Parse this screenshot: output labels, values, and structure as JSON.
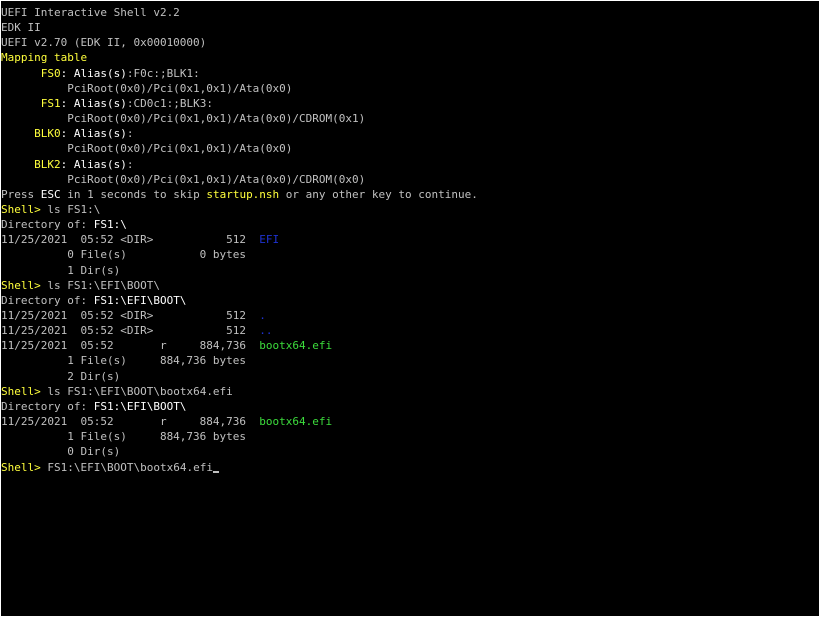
{
  "colors": {
    "background": "#000000",
    "text": "#c0c0c0",
    "highlight": "#ffffff",
    "prompt": "#ffff3c",
    "directory": "#1e32d2",
    "executable": "#3cdc3c"
  },
  "lines": [
    {
      "segments": [
        {
          "text": "UEFI Interactive Shell v2.2",
          "color": "gray"
        }
      ]
    },
    {
      "segments": [
        {
          "text": "EDK II",
          "color": "gray"
        }
      ]
    },
    {
      "segments": [
        {
          "text": "UEFI v2.70 (EDK II, 0x00010000)",
          "color": "gray"
        }
      ]
    },
    {
      "segments": [
        {
          "text": "Mapping table",
          "color": "yellow"
        }
      ]
    },
    {
      "segments": [
        {
          "text": "      FS0",
          "color": "yellow"
        },
        {
          "text": ": Alias(s)",
          "color": "white"
        },
        {
          "text": ":F0c:;BLK1:",
          "color": "gray"
        }
      ]
    },
    {
      "segments": [
        {
          "text": "          PciRoot(0x0)/Pci(0x1,0x1)/Ata(0x0)",
          "color": "gray"
        }
      ]
    },
    {
      "segments": [
        {
          "text": "      FS1",
          "color": "yellow"
        },
        {
          "text": ": Alias(s)",
          "color": "white"
        },
        {
          "text": ":CD0c1:;BLK3:",
          "color": "gray"
        }
      ]
    },
    {
      "segments": [
        {
          "text": "          PciRoot(0x0)/Pci(0x1,0x1)/Ata(0x0)/CDROM(0x1)",
          "color": "gray"
        }
      ]
    },
    {
      "segments": [
        {
          "text": "     BLK0",
          "color": "yellow"
        },
        {
          "text": ": Alias(s)",
          "color": "white"
        },
        {
          "text": ":",
          "color": "gray"
        }
      ]
    },
    {
      "segments": [
        {
          "text": "          PciRoot(0x0)/Pci(0x1,0x1)/Ata(0x0)",
          "color": "gray"
        }
      ]
    },
    {
      "segments": [
        {
          "text": "     BLK2",
          "color": "yellow"
        },
        {
          "text": ": Alias(s)",
          "color": "white"
        },
        {
          "text": ":",
          "color": "gray"
        }
      ]
    },
    {
      "segments": [
        {
          "text": "          PciRoot(0x0)/Pci(0x1,0x1)/Ata(0x0)/CDROM(0x0)",
          "color": "gray"
        }
      ]
    },
    {
      "segments": [
        {
          "text": "Press ",
          "color": "gray"
        },
        {
          "text": "ESC",
          "color": "white"
        },
        {
          "text": " in 1 seconds to skip ",
          "color": "gray"
        },
        {
          "text": "startup.nsh",
          "color": "yellow"
        },
        {
          "text": " or any other key to continue.",
          "color": "gray"
        }
      ]
    },
    {
      "segments": [
        {
          "text": "Shell>",
          "color": "yellow"
        },
        {
          "text": " ls FS1:\\",
          "color": "gray"
        }
      ]
    },
    {
      "segments": [
        {
          "text": "Directory of: ",
          "color": "gray"
        },
        {
          "text": "FS1:\\",
          "color": "white"
        }
      ]
    },
    {
      "segments": [
        {
          "text": "11/25/2021  05:52 <DIR>           512  ",
          "color": "gray"
        },
        {
          "text": "EFI",
          "color": "blue"
        }
      ]
    },
    {
      "segments": [
        {
          "text": "          0 File(s)           0 bytes",
          "color": "gray"
        }
      ]
    },
    {
      "segments": [
        {
          "text": "          1 Dir(s)",
          "color": "gray"
        }
      ]
    },
    {
      "segments": [
        {
          "text": "Shell>",
          "color": "yellow"
        },
        {
          "text": " ls FS1:\\EFI\\BOOT\\",
          "color": "gray"
        }
      ]
    },
    {
      "segments": [
        {
          "text": "Directory of: ",
          "color": "gray"
        },
        {
          "text": "FS1:\\EFI\\BOOT\\",
          "color": "white"
        }
      ]
    },
    {
      "segments": [
        {
          "text": "11/25/2021  05:52 <DIR>           512  ",
          "color": "gray"
        },
        {
          "text": ".",
          "color": "blue"
        }
      ]
    },
    {
      "segments": [
        {
          "text": "11/25/2021  05:52 <DIR>           512  ",
          "color": "gray"
        },
        {
          "text": "..",
          "color": "blue"
        }
      ]
    },
    {
      "segments": [
        {
          "text": "11/25/2021  05:52       r     884,736  ",
          "color": "gray"
        },
        {
          "text": "bootx64.efi",
          "color": "green"
        }
      ]
    },
    {
      "segments": [
        {
          "text": "          1 File(s)     884,736 bytes",
          "color": "gray"
        }
      ]
    },
    {
      "segments": [
        {
          "text": "          2 Dir(s)",
          "color": "gray"
        }
      ]
    },
    {
      "segments": [
        {
          "text": "Shell>",
          "color": "yellow"
        },
        {
          "text": " ls FS1:\\EFI\\BOOT\\bootx64.efi",
          "color": "gray"
        }
      ]
    },
    {
      "segments": [
        {
          "text": "Directory of: ",
          "color": "gray"
        },
        {
          "text": "FS1:\\EFI\\BOOT\\",
          "color": "white"
        }
      ]
    },
    {
      "segments": [
        {
          "text": "11/25/2021  05:52       r     884,736  ",
          "color": "gray"
        },
        {
          "text": "bootx64.efi",
          "color": "green"
        }
      ]
    },
    {
      "segments": [
        {
          "text": "          1 File(s)     884,736 bytes",
          "color": "gray"
        }
      ]
    },
    {
      "segments": [
        {
          "text": "          0 Dir(s)",
          "color": "gray"
        }
      ]
    }
  ],
  "prompt": {
    "label": "Shell>",
    "input": " FS1:\\EFI\\BOOT\\bootx64.efi"
  }
}
